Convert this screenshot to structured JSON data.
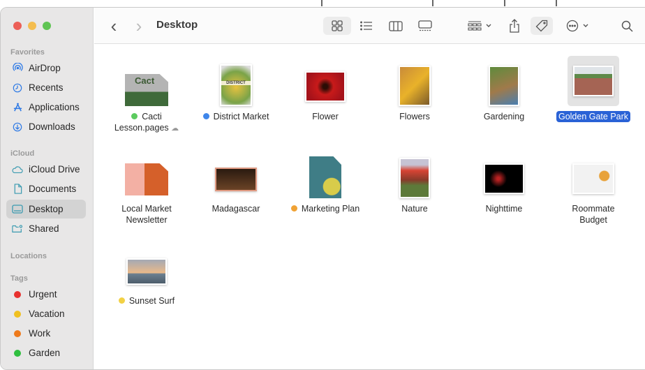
{
  "window": {
    "title": "Desktop"
  },
  "traffic_lights": {
    "close": "#ec5f57",
    "minimize": "#f4bd4f",
    "zoom": "#5fc453"
  },
  "sidebar": {
    "sections": [
      {
        "title": "Favorites",
        "items": [
          {
            "label": "AirDrop",
            "icon": "airdrop-icon"
          },
          {
            "label": "Recents",
            "icon": "clock-icon"
          },
          {
            "label": "Applications",
            "icon": "applications-icon"
          },
          {
            "label": "Downloads",
            "icon": "download-icon"
          }
        ]
      },
      {
        "title": "iCloud",
        "items": [
          {
            "label": "iCloud Drive",
            "icon": "cloud-icon"
          },
          {
            "label": "Documents",
            "icon": "document-icon"
          },
          {
            "label": "Desktop",
            "icon": "desktop-icon",
            "selected": true
          },
          {
            "label": "Shared",
            "icon": "shared-folder-icon"
          }
        ]
      },
      {
        "title": "Locations",
        "items": []
      },
      {
        "title": "Tags",
        "items": [
          {
            "label": "Urgent",
            "color": "#e8312f"
          },
          {
            "label": "Vacation",
            "color": "#f0c020"
          },
          {
            "label": "Work",
            "color": "#ee7a1b"
          },
          {
            "label": "Garden",
            "color": "#2fbf3f"
          }
        ]
      }
    ]
  },
  "toolbar": {
    "back": "‹",
    "forward": "›",
    "icons": [
      "icon-view",
      "list-view",
      "column-view",
      "gallery-view",
      "group-by",
      "share",
      "tags",
      "more-actions",
      "search"
    ]
  },
  "files": [
    {
      "name": "Cacti Lesson.pages",
      "line1": "Cacti",
      "line2": "Lesson.pages",
      "tag": "#5ccb5f",
      "cloud": true
    },
    {
      "name": "District Market",
      "tag": "#3f86ea"
    },
    {
      "name": "Flower"
    },
    {
      "name": "Flowers"
    },
    {
      "name": "Gardening"
    },
    {
      "name": "Golden Gate Park",
      "selected": true
    },
    {
      "name": "Local Market Newsletter",
      "line1": "Local Market",
      "line2": "Newsletter"
    },
    {
      "name": "Madagascar"
    },
    {
      "name": "Marketing Plan",
      "tag": "#f0a234"
    },
    {
      "name": "Nature"
    },
    {
      "name": "Nighttime"
    },
    {
      "name": "Roommate Budget",
      "line1": "Roommate",
      "line2": "Budget"
    },
    {
      "name": "Sunset Surf",
      "tag": "#f2d145"
    }
  ]
}
